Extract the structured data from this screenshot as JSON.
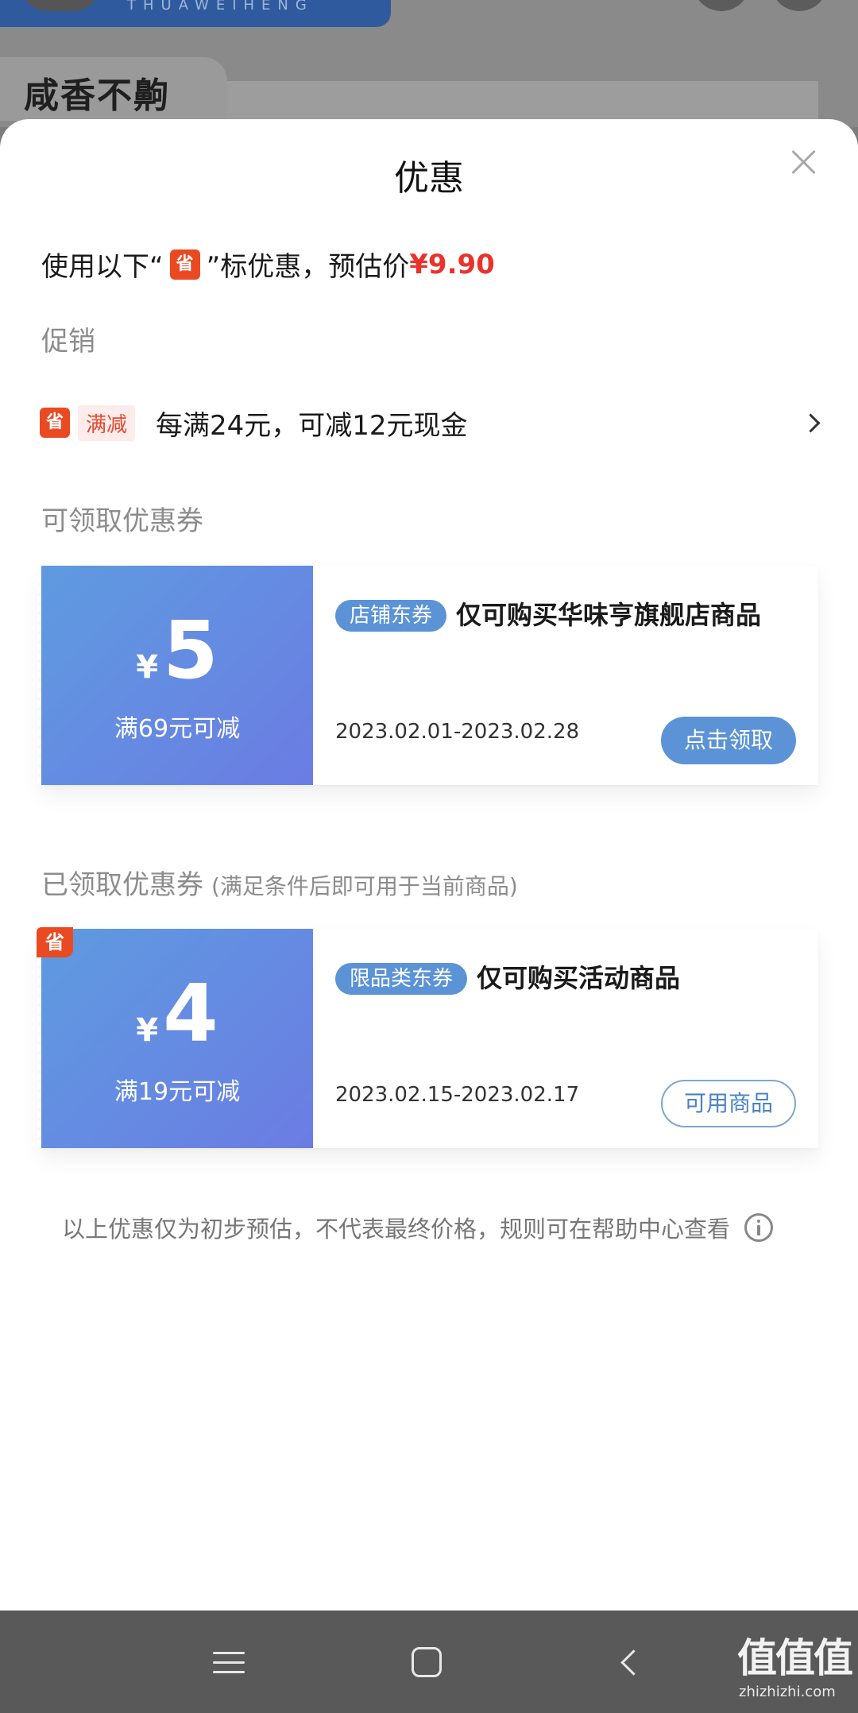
{
  "background": {
    "banner_text": "THUAWEIHENG",
    "tag_text": "咸香不齁"
  },
  "sheet": {
    "title": "优惠",
    "estimate": {
      "prefix": "使用以下“",
      "badge": "省",
      "suffix": "”标优惠，预估价",
      "price": "¥9.90"
    },
    "promo_section_label": "促销",
    "promo": {
      "badge": "省",
      "tag": "满减",
      "text": "每满24元，可减12元现金"
    },
    "available_section_label": "可领取优惠券",
    "claimed_section_label": "已领取优惠券",
    "claimed_section_note": "(满足条件后即可用于当前商品)",
    "coupons_available": [
      {
        "currency": "¥",
        "amount": "5",
        "condition": "满69元可减",
        "tag": "店铺东券",
        "description": "仅可购买华味亨旗舰店商品",
        "dates": "2023.02.01-2023.02.28",
        "action": "点击领取"
      }
    ],
    "coupons_claimed": [
      {
        "corner_badge": "省",
        "currency": "¥",
        "amount": "4",
        "condition": "满19元可减",
        "tag": "限品类东券",
        "description": "仅可购买活动商品",
        "dates": "2023.02.15-2023.02.17",
        "action": "可用商品"
      }
    ],
    "footnote": "以上优惠仅为初步预估，不代表最终价格，规则可在帮助中心查看"
  },
  "watermark": {
    "text": "值值值",
    "url": "zhizhizhi.com"
  },
  "colors": {
    "accent_red": "#e8332b",
    "badge_orange": "#ea4a22",
    "coupon_blue": "#5b93d6"
  }
}
